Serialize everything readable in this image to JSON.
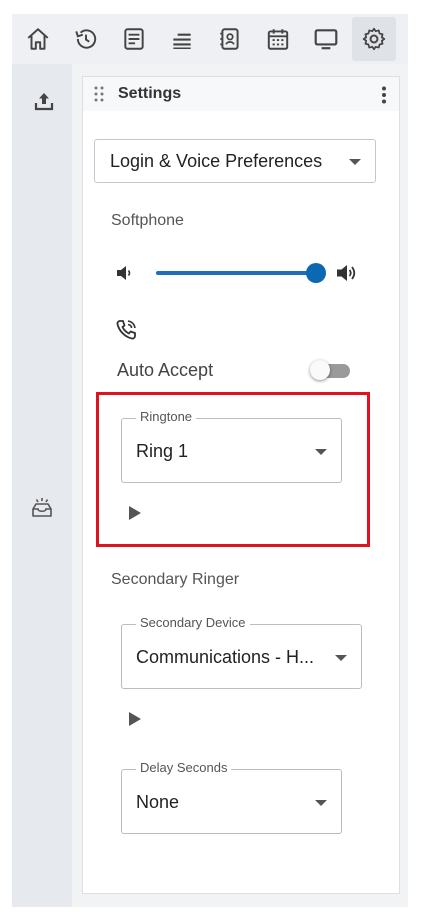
{
  "toolbar": {
    "buttons": [
      {
        "icon": "home-icon"
      },
      {
        "icon": "history-icon"
      },
      {
        "icon": "notes-icon"
      },
      {
        "icon": "queue-icon"
      },
      {
        "icon": "contacts-icon"
      },
      {
        "icon": "calendar-icon"
      },
      {
        "icon": "monitor-icon"
      },
      {
        "icon": "gear-icon",
        "active": true
      }
    ]
  },
  "sidebar": {
    "icons": [
      "upload-icon",
      "inbox-icon"
    ]
  },
  "panel": {
    "title": "Settings",
    "selected_preferences": "Login & Voice Preferences",
    "softphone": {
      "label": "Softphone",
      "volume": 1.0,
      "auto_accept_label": "Auto Accept",
      "auto_accept": false
    },
    "ringtone": {
      "label": "Ringtone",
      "value": "Ring 1"
    },
    "secondary": {
      "label": "Secondary Ringer",
      "device_label": "Secondary Device",
      "device_value": "Communications - H...",
      "delay_label": "Delay Seconds",
      "delay_value": "None"
    }
  },
  "colors": {
    "accent": "#0b69b4",
    "highlight": "#e0121d"
  }
}
